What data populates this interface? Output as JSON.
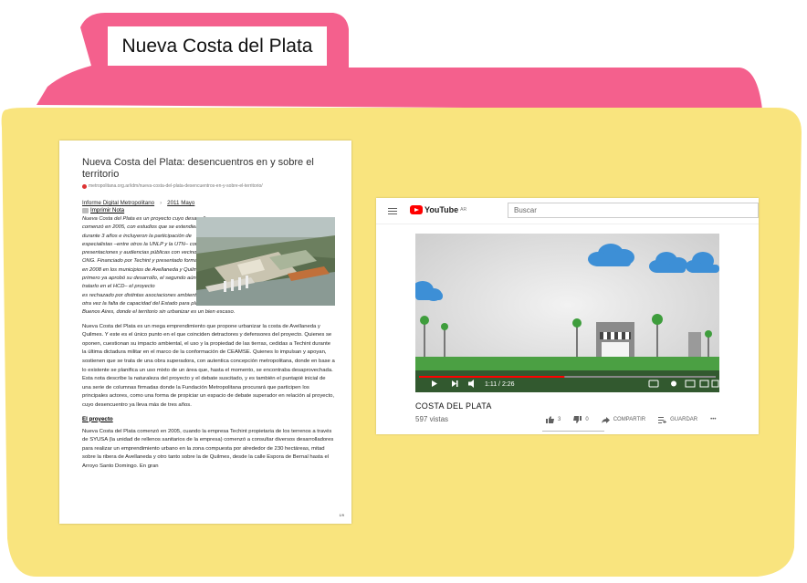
{
  "folder": {
    "tab_label": "Nueva Costa del Plata",
    "colors": {
      "tab": "#f4608d",
      "body": "#f9e47e"
    }
  },
  "article": {
    "title": "Nueva Costa del Plata: desencuentros en y sobre el territorio",
    "url": "metropolitana.org.ar/idm/nueva-costa-del-plata-desencuentros-en-y-sobre-el-territorio/",
    "source": "Informe Digital Metropolitano",
    "date": "2011 Mayo",
    "print_label": "Imprimir Nota",
    "lead_wrapped": "Nueva Costa del Plata es un proyecto cuyo desarrollo comenzó en 2005, con estudios que se extendieron durante 3 años e incluyeron la participación de especialistas –entre otros la UNLP y la UTN– consultas, presentaciones y audiencias públicas con vecinos y ONG. Financiado por Techint y presentado formalmente en 2008 en los municipios de Avellaneda y Quilmes – el primero ya aprobó su desarrollo, el segundo aún no logra tratarlo en el HCD– el proyecto",
    "lead_full": "es rechazado por distintas asociaciones ambientalistas locales. Nueva Costa del Plata deja en evidencia otra vez la falta de capacidad del Estado para planificar el uso del suelo en un espacio como la metrópolis Buenos Aires, donde el territorio sin urbanizar es un bien escaso.",
    "paragraph1": "Nueva Costa del Plata es un mega emprendimiento que propone urbanizar la costa de Avellaneda y Quilmes. Y este es el único punto en el que coinciden detractores y defensores del proyecto. Quienes se oponen, cuestionan su impacto ambiental, el uso y la propiedad de las tierras, cedidas a Techint durante la última dictadura militar en el marco de la conformación de CEAMSE. Quienes lo impulsan y apoyan, sostienen que se trata de una obra superadora, con autentica concepción metropolitana, donde en base a lo existente se planifica un uso mixto de un área que, hasta el momento, se encontraba desaprovechada. Esta nota describe la naturaleza del proyecto y el debate suscitado, y es también el puntapié inicial de una serie de columnas firmadas donde la Fundación Metropolitana procurará que participen los principales actores, como una forma de propiciar un espacio de debate superador en relación al proyecto, cuyo desencuentro ya lleva más de tres años.",
    "subheading": "El proyecto",
    "paragraph2": "Nueva Costa del Plata comenzó en 2005, cuando la empresa Techint propietaria de los terrenos a través de SYUSA (la unidad de rellenos sanitarios de la empresa) comenzó a consultar diversos desarrolladores para realizar un emprendimiento urbano en la zona compuesta por alrededor de 230 hectáreas, mitad sobre la ribera de Avellaneda y otro tanto sobre la de Quilmes, desde la calle Espora de Bernal hasta el Arroyo Santo Domingo. En gran",
    "corner_mark": "1/9"
  },
  "video": {
    "brand": "YouTube",
    "brand_suffix": "AR",
    "search_placeholder": "Buscar",
    "time": "1:11 / 2:26",
    "progress": 0.49,
    "title": "COSTA DEL PLATA",
    "views": "597 vistas",
    "likes": "3",
    "dislikes": "0",
    "share_label": "COMPARTIR",
    "save_label": "GUARDAR",
    "more": "•••"
  }
}
